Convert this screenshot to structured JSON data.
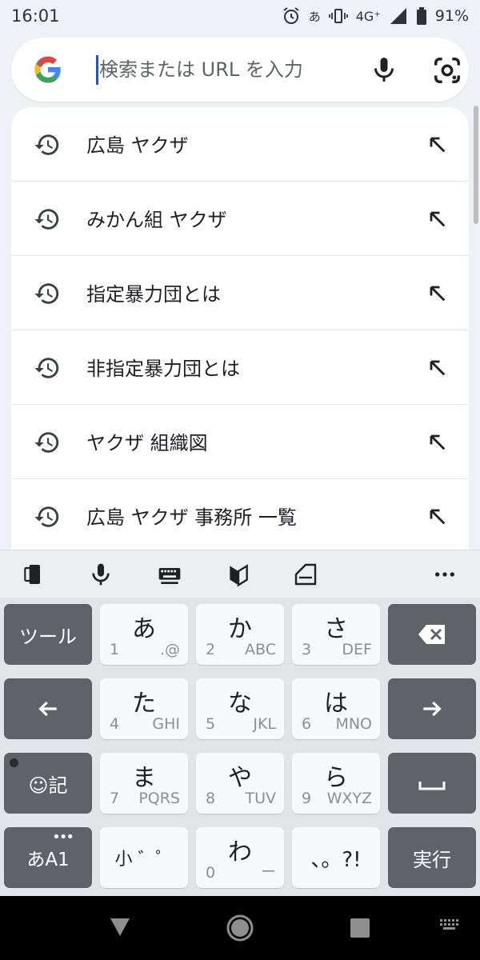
{
  "status_bar": {
    "time": "16:01",
    "ime_indicator": "あ",
    "network": "4G⁺",
    "battery": "91%",
    "icons": [
      "alarm-icon",
      "vibrate-icon",
      "signal-icon",
      "battery-icon"
    ]
  },
  "search": {
    "placeholder": "検索または URL を入力",
    "value": "",
    "icons": [
      "google-logo-icon",
      "mic-icon",
      "google-lens-icon"
    ]
  },
  "suggestions": [
    {
      "text": "広島 ヤクザ"
    },
    {
      "text": "みかん組 ヤクザ"
    },
    {
      "text": "指定暴力団とは"
    },
    {
      "text": "非指定暴力団とは"
    },
    {
      "text": "ヤクザ 組織図"
    },
    {
      "text": "広島 ヤクザ 事務所 一覧"
    }
  ],
  "keyboard_toolbar": {
    "icons": [
      "one-hand-mode-icon",
      "voice-input-icon",
      "keyboard-switch-icon",
      "beginner-mark-icon",
      "clipboard-icon",
      "more-icon"
    ]
  },
  "keyboard": {
    "rows": [
      [
        {
          "main": "ツール"
        },
        {
          "main": "あ",
          "sub_l": "1",
          "sub_r": ".@"
        },
        {
          "main": "か",
          "sub_l": "2",
          "sub_r": "ABC"
        },
        {
          "main": "さ",
          "sub_l": "3",
          "sub_r": "DEF"
        },
        {
          "main": "",
          "icon": "backspace-icon"
        }
      ],
      [
        {
          "main": "",
          "icon": "arrow-left-icon"
        },
        {
          "main": "た",
          "sub_l": "4",
          "sub_r": "GHI"
        },
        {
          "main": "な",
          "sub_l": "5",
          "sub_r": "JKL"
        },
        {
          "main": "は",
          "sub_l": "6",
          "sub_r": "MNO"
        },
        {
          "main": "",
          "icon": "arrow-right-icon"
        }
      ],
      [
        {
          "main": "☺記"
        },
        {
          "main": "ま",
          "sub_l": "7",
          "sub_r": "PQRS"
        },
        {
          "main": "や",
          "sub_l": "8",
          "sub_r": "TUV"
        },
        {
          "main": "ら",
          "sub_l": "9",
          "sub_r": "WXYZ"
        },
        {
          "main": "",
          "icon": "space-icon"
        }
      ],
      [
        {
          "main": "あA1"
        },
        {
          "main": "小 ゛゜"
        },
        {
          "main": "わ",
          "sub_l": "0",
          "sub_r": "ー"
        },
        {
          "main": "、。?!"
        },
        {
          "main": "実行"
        }
      ]
    ]
  },
  "nav_bar": {
    "icons": [
      "back-triangle-icon",
      "home-circle-icon",
      "recents-square-icon",
      "keyboard-hide-icon"
    ]
  },
  "colors": {
    "accent": "#1a55d6",
    "dark_key": "#5f6368",
    "light_key": "#f8f9fa",
    "background": "#eef1f6"
  }
}
